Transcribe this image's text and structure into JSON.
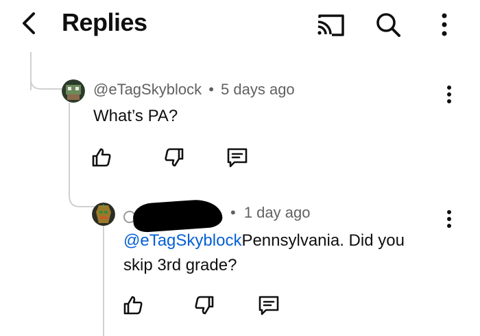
{
  "header": {
    "title": "Replies",
    "icons": [
      "back-arrow-icon",
      "cast-icon",
      "search-icon",
      "more-vert-icon"
    ]
  },
  "comments": [
    {
      "author": "@eTagSkyblock",
      "separator": "•",
      "time": "5 days ago",
      "text": "What’s PA?",
      "actions": [
        "thumbs-up-icon",
        "thumbs-down-icon",
        "reply-icon"
      ]
    },
    {
      "author": "",
      "author_redacted": true,
      "separator": "•",
      "time": "1 day ago",
      "mention": "@eTagSkyblock",
      "text_line1": "Pennsylvania. Did you",
      "text_line2": "skip 3rd grade?",
      "actions": [
        "thumbs-up-icon",
        "thumbs-down-icon",
        "reply-icon"
      ]
    }
  ],
  "colors": {
    "mention": "#065fd4",
    "meta": "#606060",
    "thread_line": "#d0d0d0"
  }
}
